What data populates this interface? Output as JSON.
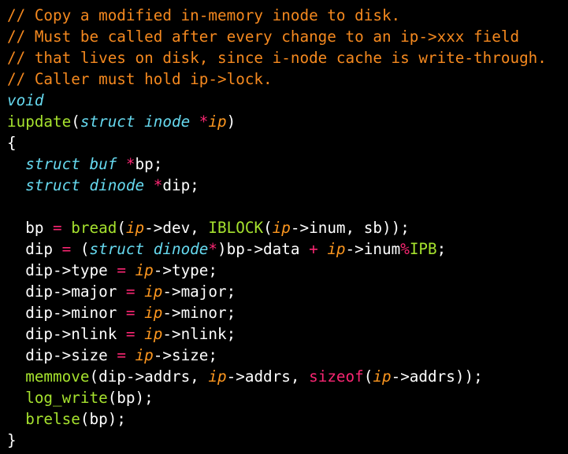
{
  "colors": {
    "background": "#000000",
    "comment": "#f5891f",
    "type": "#66d9ef",
    "parameter": "#fd971f",
    "operator": "#f92672",
    "function": "#a6e22e",
    "plain": "#ffffff"
  },
  "code": {
    "lines": [
      [
        {
          "t": "// Copy a modified in-memory inode to disk.",
          "c": "comment"
        }
      ],
      [
        {
          "t": "// Must be called after every change to an ip->xxx field",
          "c": "comment"
        }
      ],
      [
        {
          "t": "// that lives on disk, since i-node cache is write-through.",
          "c": "comment"
        }
      ],
      [
        {
          "t": "// Caller must hold ip->lock.",
          "c": "comment"
        }
      ],
      [
        {
          "t": "void",
          "c": "type"
        }
      ],
      [
        {
          "t": "iupdate",
          "c": "fn"
        },
        {
          "t": "(",
          "c": "plain"
        },
        {
          "t": "struct inode ",
          "c": "type"
        },
        {
          "t": "*",
          "c": "op"
        },
        {
          "t": "ip",
          "c": "param"
        },
        {
          "t": ")",
          "c": "plain"
        }
      ],
      [
        {
          "t": "{",
          "c": "plain"
        }
      ],
      [
        {
          "t": "  ",
          "c": "plain"
        },
        {
          "t": "struct buf ",
          "c": "type"
        },
        {
          "t": "*",
          "c": "op"
        },
        {
          "t": "bp;",
          "c": "plain"
        }
      ],
      [
        {
          "t": "  ",
          "c": "plain"
        },
        {
          "t": "struct dinode ",
          "c": "type"
        },
        {
          "t": "*",
          "c": "op"
        },
        {
          "t": "dip;",
          "c": "plain"
        }
      ],
      [
        {
          "t": "",
          "c": "plain"
        }
      ],
      [
        {
          "t": "  bp ",
          "c": "plain"
        },
        {
          "t": "=",
          "c": "op"
        },
        {
          "t": " ",
          "c": "plain"
        },
        {
          "t": "bread",
          "c": "fn"
        },
        {
          "t": "(",
          "c": "plain"
        },
        {
          "t": "ip",
          "c": "param"
        },
        {
          "t": "->dev, ",
          "c": "plain"
        },
        {
          "t": "IBLOCK",
          "c": "fn"
        },
        {
          "t": "(",
          "c": "plain"
        },
        {
          "t": "ip",
          "c": "param"
        },
        {
          "t": "->inum, sb));",
          "c": "plain"
        }
      ],
      [
        {
          "t": "  dip ",
          "c": "plain"
        },
        {
          "t": "=",
          "c": "op"
        },
        {
          "t": " (",
          "c": "plain"
        },
        {
          "t": "struct dinode",
          "c": "type"
        },
        {
          "t": "*",
          "c": "op"
        },
        {
          "t": ")bp->data ",
          "c": "plain"
        },
        {
          "t": "+",
          "c": "op"
        },
        {
          "t": " ",
          "c": "plain"
        },
        {
          "t": "ip",
          "c": "param"
        },
        {
          "t": "->inum",
          "c": "plain"
        },
        {
          "t": "%",
          "c": "op"
        },
        {
          "t": "IPB",
          "c": "fn"
        },
        {
          "t": ";",
          "c": "plain"
        }
      ],
      [
        {
          "t": "  dip->type ",
          "c": "plain"
        },
        {
          "t": "=",
          "c": "op"
        },
        {
          "t": " ",
          "c": "plain"
        },
        {
          "t": "ip",
          "c": "param"
        },
        {
          "t": "->type;",
          "c": "plain"
        }
      ],
      [
        {
          "t": "  dip->major ",
          "c": "plain"
        },
        {
          "t": "=",
          "c": "op"
        },
        {
          "t": " ",
          "c": "plain"
        },
        {
          "t": "ip",
          "c": "param"
        },
        {
          "t": "->major;",
          "c": "plain"
        }
      ],
      [
        {
          "t": "  dip->minor ",
          "c": "plain"
        },
        {
          "t": "=",
          "c": "op"
        },
        {
          "t": " ",
          "c": "plain"
        },
        {
          "t": "ip",
          "c": "param"
        },
        {
          "t": "->minor;",
          "c": "plain"
        }
      ],
      [
        {
          "t": "  dip->nlink ",
          "c": "plain"
        },
        {
          "t": "=",
          "c": "op"
        },
        {
          "t": " ",
          "c": "plain"
        },
        {
          "t": "ip",
          "c": "param"
        },
        {
          "t": "->nlink;",
          "c": "plain"
        }
      ],
      [
        {
          "t": "  dip->size ",
          "c": "plain"
        },
        {
          "t": "=",
          "c": "op"
        },
        {
          "t": " ",
          "c": "plain"
        },
        {
          "t": "ip",
          "c": "param"
        },
        {
          "t": "->size;",
          "c": "plain"
        }
      ],
      [
        {
          "t": "  ",
          "c": "plain"
        },
        {
          "t": "memmove",
          "c": "fn"
        },
        {
          "t": "(dip->addrs, ",
          "c": "plain"
        },
        {
          "t": "ip",
          "c": "param"
        },
        {
          "t": "->addrs, ",
          "c": "plain"
        },
        {
          "t": "sizeof",
          "c": "kw"
        },
        {
          "t": "(",
          "c": "plain"
        },
        {
          "t": "ip",
          "c": "param"
        },
        {
          "t": "->addrs));",
          "c": "plain"
        }
      ],
      [
        {
          "t": "  ",
          "c": "plain"
        },
        {
          "t": "log_write",
          "c": "fn"
        },
        {
          "t": "(bp);",
          "c": "plain"
        }
      ],
      [
        {
          "t": "  ",
          "c": "plain"
        },
        {
          "t": "brelse",
          "c": "fn"
        },
        {
          "t": "(bp);",
          "c": "plain"
        }
      ],
      [
        {
          "t": "}",
          "c": "plain"
        }
      ]
    ]
  }
}
